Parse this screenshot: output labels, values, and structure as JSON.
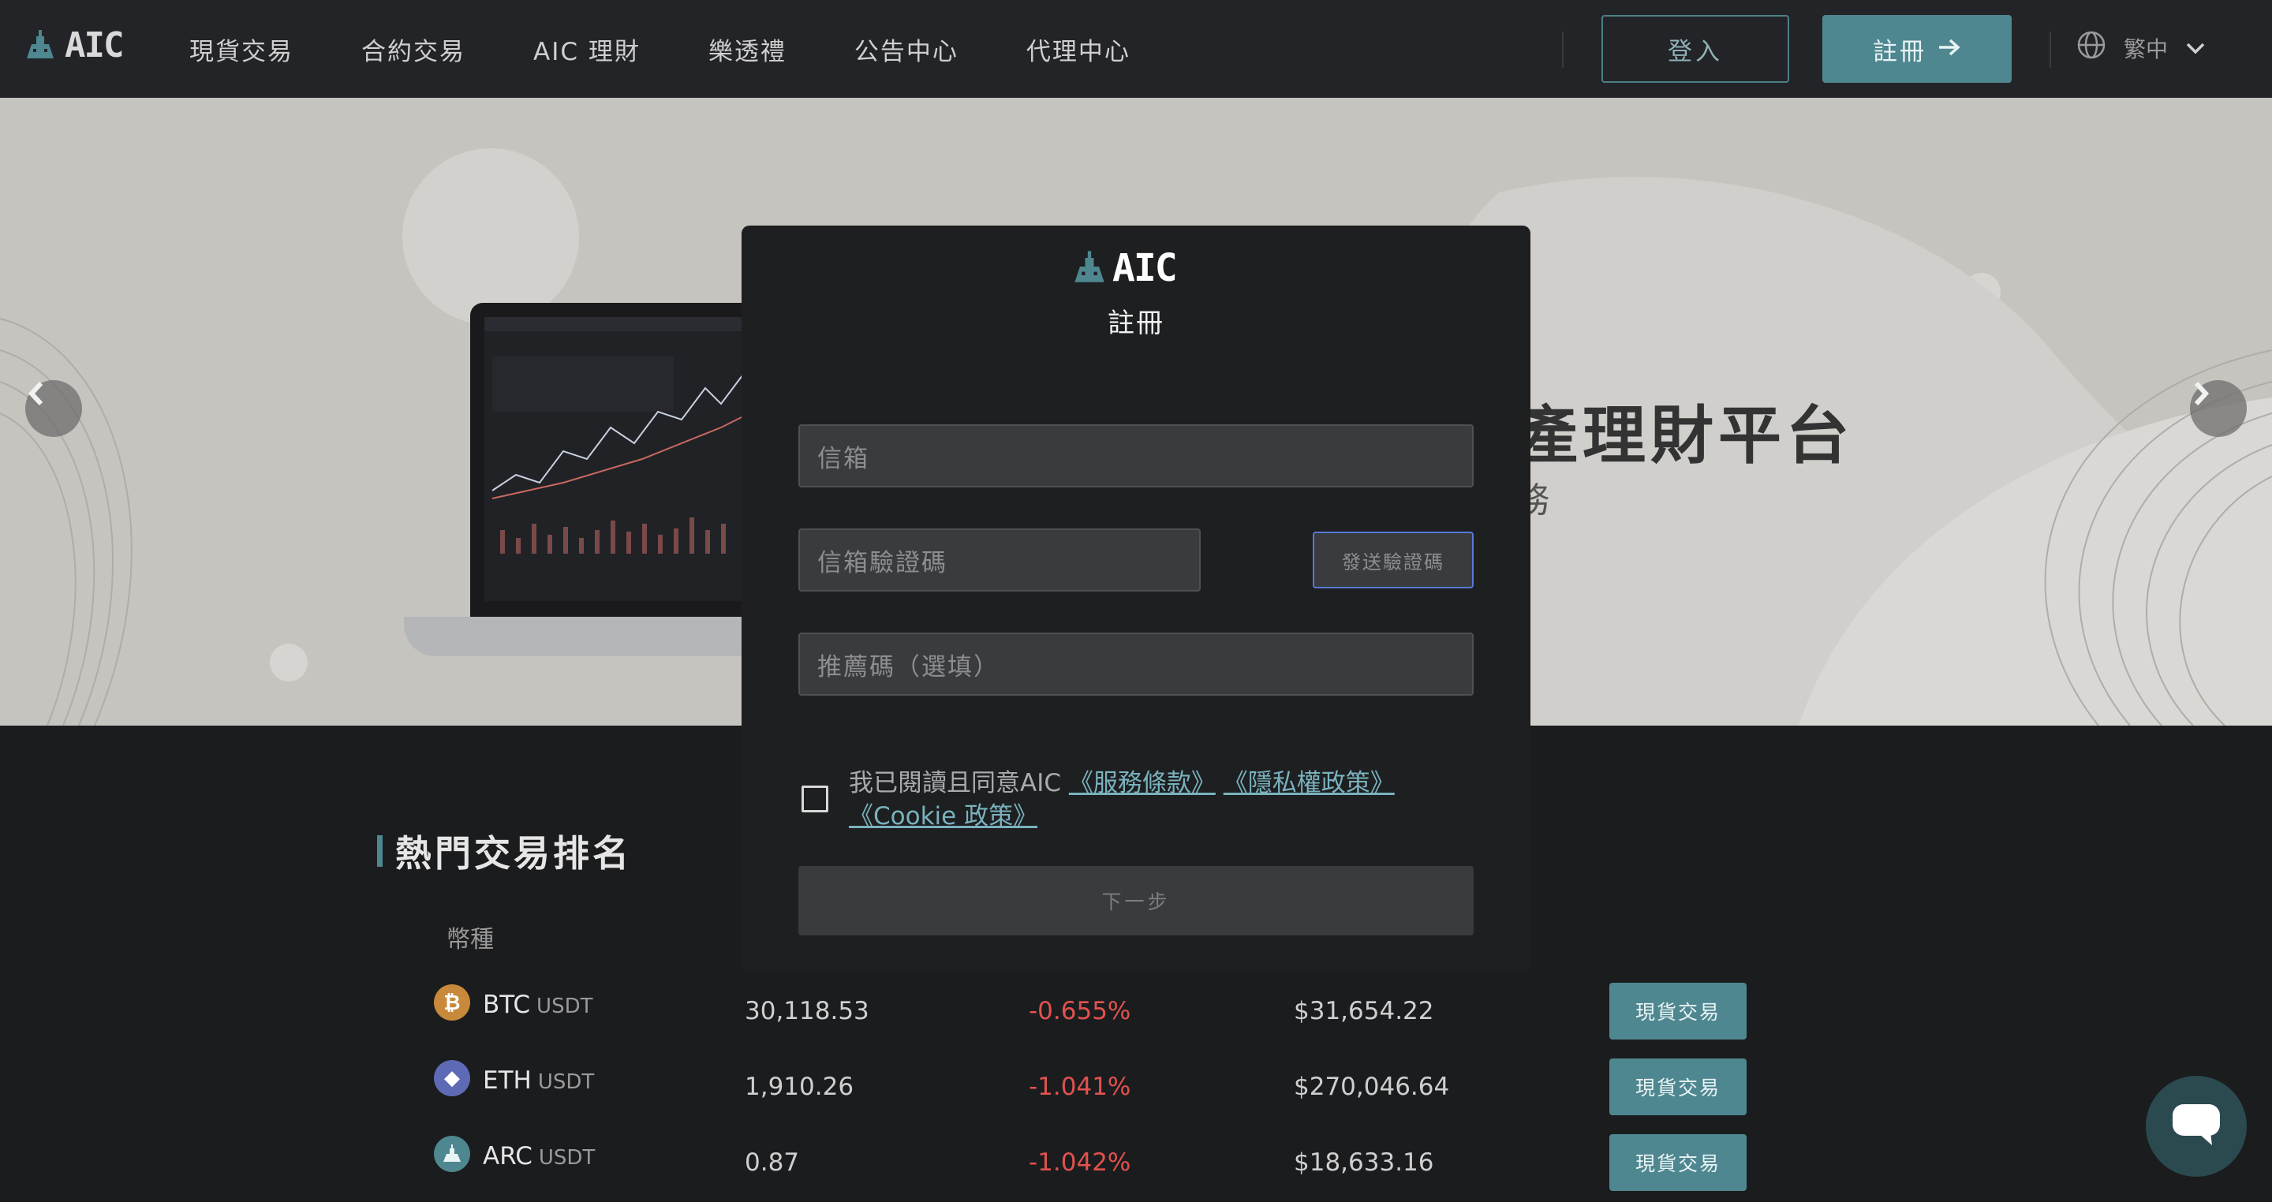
{
  "header": {
    "logo_text": "AIC",
    "nav": [
      "現貨交易",
      "合約交易",
      "AIC 理財",
      "樂透禮",
      "公告中心",
      "代理中心"
    ],
    "login_label": "登入",
    "register_label": "註冊",
    "language": "繁中"
  },
  "hero": {
    "title_visible": "產理財平台",
    "subtitle_visible": "務"
  },
  "ranking": {
    "title": "熱門交易排名",
    "col_coin": "幣種",
    "rows": [
      {
        "coin": "BTC",
        "quote": "USDT",
        "price": "30,118.53",
        "change": "-0.655%",
        "volume": "$31,654.22",
        "action": "現貨交易"
      },
      {
        "coin": "ETH",
        "quote": "USDT",
        "price": "1,910.26",
        "change": "-1.041%",
        "volume": "$270,046.64",
        "action": "現貨交易"
      },
      {
        "coin": "ARC",
        "quote": "USDT",
        "price": "0.87",
        "change": "-1.042%",
        "volume": "$18,633.16",
        "action": "現貨交易"
      }
    ]
  },
  "modal": {
    "logo_text": "AIC",
    "title": "註冊",
    "email_placeholder": "信箱",
    "code_placeholder": "信箱驗證碼",
    "send_code_label": "發送驗證碼",
    "referral_placeholder": "推薦碼（選填）",
    "agree_prefix": "我已閱讀且同意AIC",
    "terms_link": "《服務條款》",
    "privacy_link": "《隱私權政策》",
    "cookie_link": "《Cookie 政策》",
    "next_label": "下一步"
  },
  "colors": {
    "accent": "#4f8790",
    "negative": "#e0524f",
    "header_bg": "#232427",
    "page_bg": "#1b1c1e"
  },
  "icons": {
    "logo": "aic-logo-icon",
    "language": "globe-icon",
    "language_caret": "chevron-down-icon",
    "carousel_prev": "chevron-left-icon",
    "carousel_next": "chevron-right-icon",
    "chat": "chat-bubble-icon"
  }
}
